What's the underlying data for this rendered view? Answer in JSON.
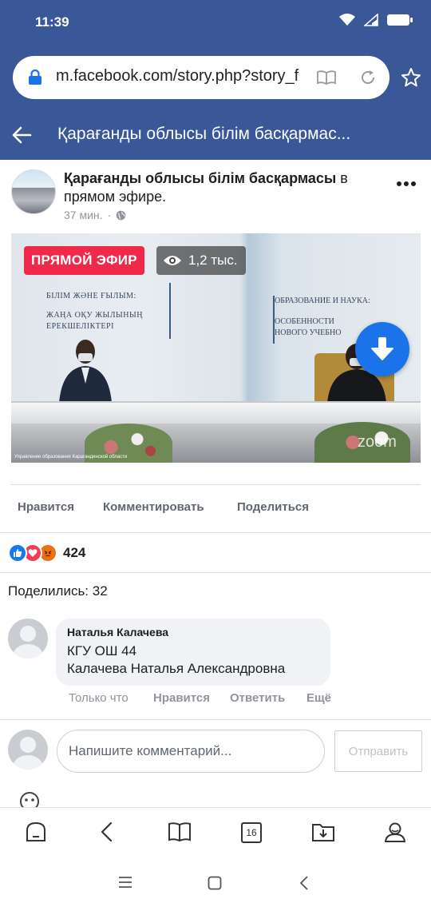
{
  "status_bar": {
    "time": "11:39"
  },
  "browser": {
    "url": "m.facebook.com/story.php?story_f"
  },
  "header": {
    "title": "Қарағанды облысы білім басқармас..."
  },
  "post": {
    "author": "Қарағанды облысы білім басқармасы",
    "activity": " в прямом эфире.",
    "time_ago": "37 мин.",
    "video": {
      "live_label": "ПРЯМОЙ ЭФИР",
      "viewers": "1,2 тыс.",
      "wall_left": [
        "БІЛІМ ЖӘНЕ ҒЫЛЫМ:",
        "ЖАҢА ОҚУ ЖЫЛЫНЫҢ",
        "ЕРЕКШЕЛІКТЕРІ"
      ],
      "wall_right": [
        "ОБРАЗОВАНИЕ И НАУКА:",
        "ОСОБЕННОСТИ",
        "НОВОГО УЧЕБНО"
      ],
      "watermark": "zoom",
      "caption": "Управление образования Карагандинской области"
    }
  },
  "actions": {
    "like": "Нравится",
    "comment": "Комментировать",
    "share": "Поделиться"
  },
  "reactions": {
    "count": "424",
    "colors": {
      "like": "#1877f2",
      "love": "#f33e58",
      "angry": "#e9710f"
    }
  },
  "shares": {
    "label": "Поделились: 32"
  },
  "comment": {
    "author": "Наталья Калачева",
    "line1": "КГУ ОШ 44",
    "line2": "Калачева Наталья Александровна",
    "time": "Только что",
    "like": "Нравится",
    "reply": "Ответить",
    "more": "Ещё"
  },
  "compose": {
    "placeholder": "Напишите комментарий...",
    "send": "Отправить"
  },
  "browser_nav": {
    "tabs_count": "16"
  },
  "icons": [
    "wifi-icon",
    "signal-icon",
    "battery-icon",
    "lock-icon",
    "reader-mode-icon",
    "reload-icon",
    "star-icon",
    "back-arrow-icon",
    "more-dots-icon",
    "globe-icon",
    "eye-icon",
    "download-icon",
    "home-icon",
    "chevron-left-icon",
    "book-icon",
    "tabs-icon",
    "downloads-folder-icon",
    "profile-icon",
    "menu-icon",
    "square-icon"
  ]
}
